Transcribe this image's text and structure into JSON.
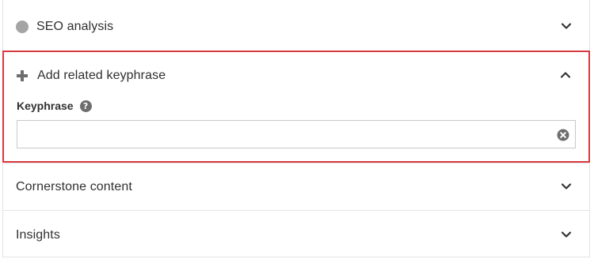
{
  "sections": {
    "seo_analysis": {
      "label": "SEO analysis",
      "status_color": "#a5a5a5",
      "icon": "chevron-down-icon"
    },
    "related_keyphrase": {
      "label": "Add related keyphrase",
      "icon": "chevron-up-icon",
      "highlight_color": "#d63a3f",
      "field": {
        "label": "Keyphrase",
        "help_icon_text": "?",
        "value": "",
        "placeholder": ""
      }
    },
    "cornerstone": {
      "label": "Cornerstone content",
      "icon": "chevron-down-icon"
    },
    "insights": {
      "label": "Insights",
      "icon": "chevron-down-icon"
    }
  }
}
